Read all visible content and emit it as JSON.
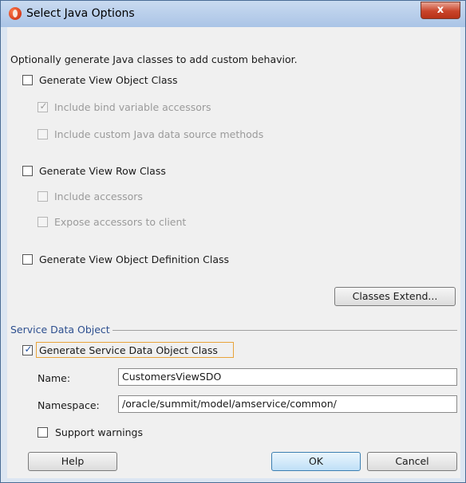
{
  "window": {
    "title": "Select Java Options",
    "close_label": "x"
  },
  "intro": "Optionally generate Java classes to add custom behavior.",
  "view_object": {
    "generate_label": "Generate View Object Class",
    "bind_accessors_label": "Include bind variable accessors",
    "custom_methods_label": "Include custom Java data source methods"
  },
  "view_row": {
    "generate_label": "Generate View Row Class",
    "include_accessors_label": "Include accessors",
    "expose_accessors_label": "Expose accessors to client"
  },
  "definition": {
    "generate_label": "Generate View Object Definition Class"
  },
  "classes_extend_label": "Classes Extend...",
  "sdo": {
    "section_title": "Service Data Object",
    "generate_label": "Generate Service Data Object Class",
    "name_label": "Name:",
    "name_value": "CustomersViewSDO",
    "namespace_label": "Namespace:",
    "namespace_value": "/oracle/summit/model/amservice/common/",
    "warnings_label": "Support warnings"
  },
  "buttons": {
    "help": "Help",
    "ok": "OK",
    "cancel": "Cancel"
  },
  "checks": {
    "checked": "✓"
  }
}
